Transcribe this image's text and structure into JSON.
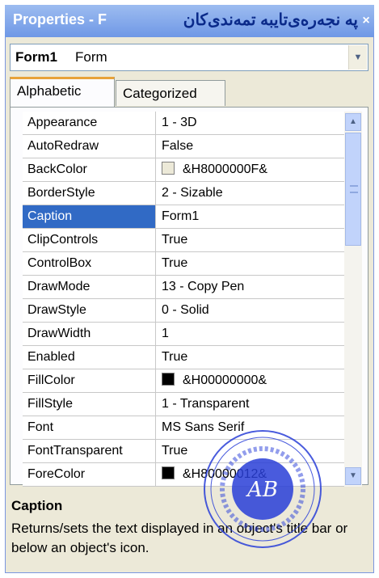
{
  "window": {
    "title": "Properties - F",
    "title_overlay": "پە نجەرەی‌تایبە تمەندی‌کان"
  },
  "object_selector": {
    "name": "Form1",
    "type": "Form"
  },
  "tabs": [
    {
      "label": "Alphabetic",
      "active": true
    },
    {
      "label": "Categorized",
      "active": false
    }
  ],
  "properties": [
    {
      "name": "Appearance",
      "value": "1 - 3D"
    },
    {
      "name": "AutoRedraw",
      "value": "False"
    },
    {
      "name": "BackColor",
      "value": "&H8000000F&",
      "swatch": "#ece9d8"
    },
    {
      "name": "BorderStyle",
      "value": "2 - Sizable"
    },
    {
      "name": "Caption",
      "value": "Form1",
      "selected": true
    },
    {
      "name": "ClipControls",
      "value": "True"
    },
    {
      "name": "ControlBox",
      "value": "True"
    },
    {
      "name": "DrawMode",
      "value": "13 - Copy Pen"
    },
    {
      "name": "DrawStyle",
      "value": "0 - Solid"
    },
    {
      "name": "DrawWidth",
      "value": "1"
    },
    {
      "name": "Enabled",
      "value": "True"
    },
    {
      "name": "FillColor",
      "value": "&H00000000&",
      "swatch": "#000000"
    },
    {
      "name": "FillStyle",
      "value": "1 - Transparent"
    },
    {
      "name": "Font",
      "value": "MS Sans Serif"
    },
    {
      "name": "FontTransparent",
      "value": "True"
    },
    {
      "name": "ForeColor",
      "value": "&H80000012&",
      "swatch": "#000000"
    }
  ],
  "description": {
    "title": "Caption",
    "text": "Returns/sets the text displayed in an object's title bar or below an object's icon."
  },
  "stamp": {
    "initials": "AB"
  },
  "colors": {
    "selection": "#316ac5",
    "titlebar": "#7a9ee8",
    "stamp": "#2a3fd8"
  }
}
